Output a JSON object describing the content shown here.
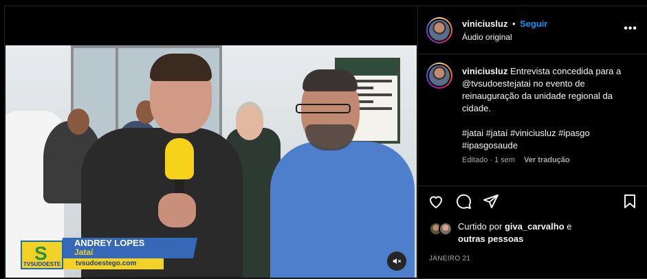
{
  "video": {
    "lower_third": {
      "logo_text": "TVSUDOESTE",
      "name": "ANDREY LOPES",
      "city": "Jataí",
      "website": "tvsudoestego.com"
    },
    "mute_icon": "speaker-muted-icon"
  },
  "header": {
    "username": "viniciusluz",
    "separator": "•",
    "follow_label": "Seguir",
    "audio_label": "Áudio original",
    "more_icon": "•••"
  },
  "caption": {
    "username": "viniciusluz",
    "text": "Entrevista concedida para a @tvsudoestejatai no evento de reinauguração da unidade regional da cidade.",
    "hashtags_line1": "#jatai #jataí #viniciusluz #ipasgo",
    "hashtags_line2": "#ipasgosaude",
    "meta": "Editado · 1 sem",
    "translate_label": "Ver tradução"
  },
  "actions": {
    "like_icon": "heart-icon",
    "comment_icon": "comment-icon",
    "share_icon": "paper-plane-icon",
    "save_icon": "bookmark-icon"
  },
  "likes": {
    "prefix": "Curtido por",
    "user": "giva_carvalho",
    "conj": "e",
    "others": "outras pessoas"
  },
  "date": "JANEIRO 21",
  "colors": {
    "background": "#000000",
    "text": "#f5f5f5",
    "secondary": "#a8a8a8",
    "link": "#0095f6",
    "border": "#262626"
  }
}
